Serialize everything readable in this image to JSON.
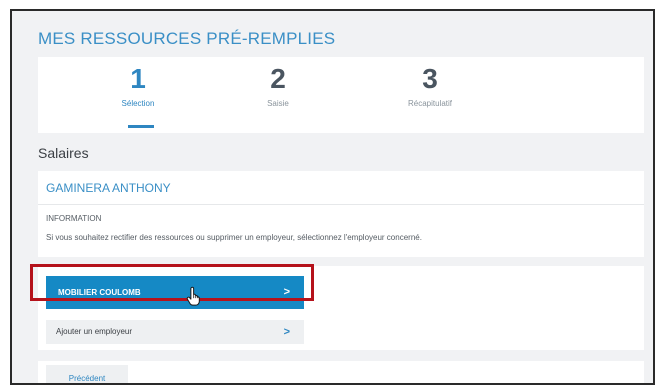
{
  "page_title": "MES RESSOURCES PRÉ-REMPLIES",
  "steps": [
    {
      "number": "1",
      "label": "Sélection",
      "active": true
    },
    {
      "number": "2",
      "label": "Saisie",
      "active": false
    },
    {
      "number": "3",
      "label": "Récapitulatif",
      "active": false
    }
  ],
  "section_title": "Salaires",
  "employer_card": {
    "name": "GAMINERA ANTHONY",
    "info_heading": "INFORMATION",
    "info_text": "Si vous souhaitez rectifier des ressources ou supprimer un employeur, sélectionnez l'employeur concerné."
  },
  "employers": [
    {
      "label": "MOBILIER COULOMB",
      "chevron": ">"
    }
  ],
  "add_employer": {
    "label": "Ajouter un employeur",
    "chevron": ">"
  },
  "previous_button": "Précédent",
  "colors": {
    "accent": "#1589c5",
    "title_blue": "#3a8fc6",
    "highlight_red": "#b5121b",
    "background": "#f1f2f4"
  },
  "icons": {
    "cursor": "hand-pointer-icon",
    "chevron": "chevron-right-icon"
  }
}
